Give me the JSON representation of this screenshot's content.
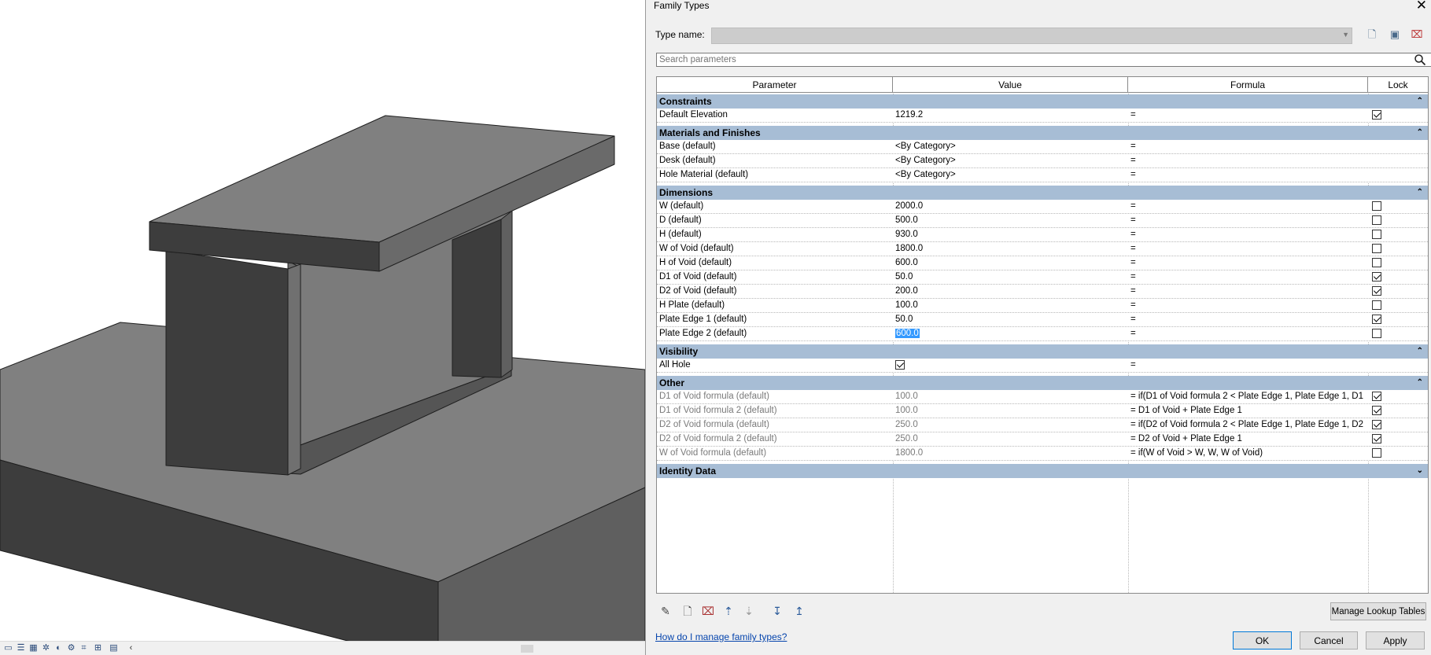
{
  "dialog": {
    "title": "Family Types",
    "type_name_label": "Type name:",
    "type_name_value": "",
    "search_placeholder": "Search parameters",
    "manage_lookup_label": "Manage Lookup Tables",
    "help_link": "How do I manage family types?",
    "ok_label": "OK",
    "cancel_label": "Cancel",
    "apply_label": "Apply"
  },
  "columns": {
    "parameter": "Parameter",
    "value": "Value",
    "formula": "Formula",
    "lock": "Lock"
  },
  "groups": {
    "constraints": "Constraints",
    "materials": "Materials and Finishes",
    "dimensions": "Dimensions",
    "visibility": "Visibility",
    "other": "Other",
    "identity": "Identity Data"
  },
  "rows": {
    "default_elevation": {
      "name": "Default Elevation",
      "value": "1219.2",
      "formula": "=",
      "locked": true
    },
    "base": {
      "name": "Base (default)",
      "value": "<By Category>",
      "formula": "="
    },
    "desk": {
      "name": "Desk (default)",
      "value": "<By Category>",
      "formula": "="
    },
    "hole_material": {
      "name": "Hole Material (default)",
      "value": "<By Category>",
      "formula": "="
    },
    "w": {
      "name": "W (default)",
      "value": "2000.0",
      "formula": "=",
      "locked": false
    },
    "d": {
      "name": "D (default)",
      "value": "500.0",
      "formula": "=",
      "locked": false
    },
    "h": {
      "name": "H (default)",
      "value": "930.0",
      "formula": "=",
      "locked": false
    },
    "w_void": {
      "name": "W of Void (default)",
      "value": "1800.0",
      "formula": "=",
      "locked": false
    },
    "h_void": {
      "name": "H of Void (default)",
      "value": "600.0",
      "formula": "=",
      "locked": false
    },
    "d1_void": {
      "name": "D1 of Void (default)",
      "value": "50.0",
      "formula": "=",
      "locked": true
    },
    "d2_void": {
      "name": "D2 of Void (default)",
      "value": "200.0",
      "formula": "=",
      "locked": true
    },
    "h_plate": {
      "name": "H Plate (default)",
      "value": "100.0",
      "formula": "=",
      "locked": false
    },
    "plate_edge_1": {
      "name": "Plate Edge 1 (default)",
      "value": "50.0",
      "formula": "=",
      "locked": true
    },
    "plate_edge_2": {
      "name": "Plate Edge 2 (default)",
      "value": "600.0",
      "formula": "=",
      "locked": false
    },
    "all_hole": {
      "name": "All Hole",
      "checked": true,
      "formula": "="
    },
    "d1_formula": {
      "name": "D1 of Void formula (default)",
      "value": "100.0",
      "formula": "= if(D1 of Void formula 2 < Plate Edge 1, Plate Edge 1, D1",
      "locked": true
    },
    "d1_formula_2": {
      "name": "D1 of Void formula 2 (default)",
      "value": "100.0",
      "formula": "= D1 of Void + Plate Edge 1",
      "locked": true
    },
    "d2_formula": {
      "name": "D2 of Void formula (default)",
      "value": "250.0",
      "formula": "= if(D2 of Void formula 2 < Plate Edge 1, Plate Edge 1, D2",
      "locked": true
    },
    "d2_formula_2": {
      "name": "D2 of Void formula 2 (default)",
      "value": "250.0",
      "formula": "= D2 of Void + Plate Edge 1",
      "locked": true
    },
    "w_formula": {
      "name": "W of Void formula (default)",
      "value": "1800.0",
      "formula": "= if(W of Void > W, W, W of Void)",
      "locked": false
    }
  },
  "colors": {
    "group_header": "#a7bdd5",
    "selection": "#3399ff",
    "link": "#0645ad",
    "model_top": "#808080",
    "model_side_dark": "#3d3d3d",
    "model_side_mid": "#6b6b6b"
  }
}
